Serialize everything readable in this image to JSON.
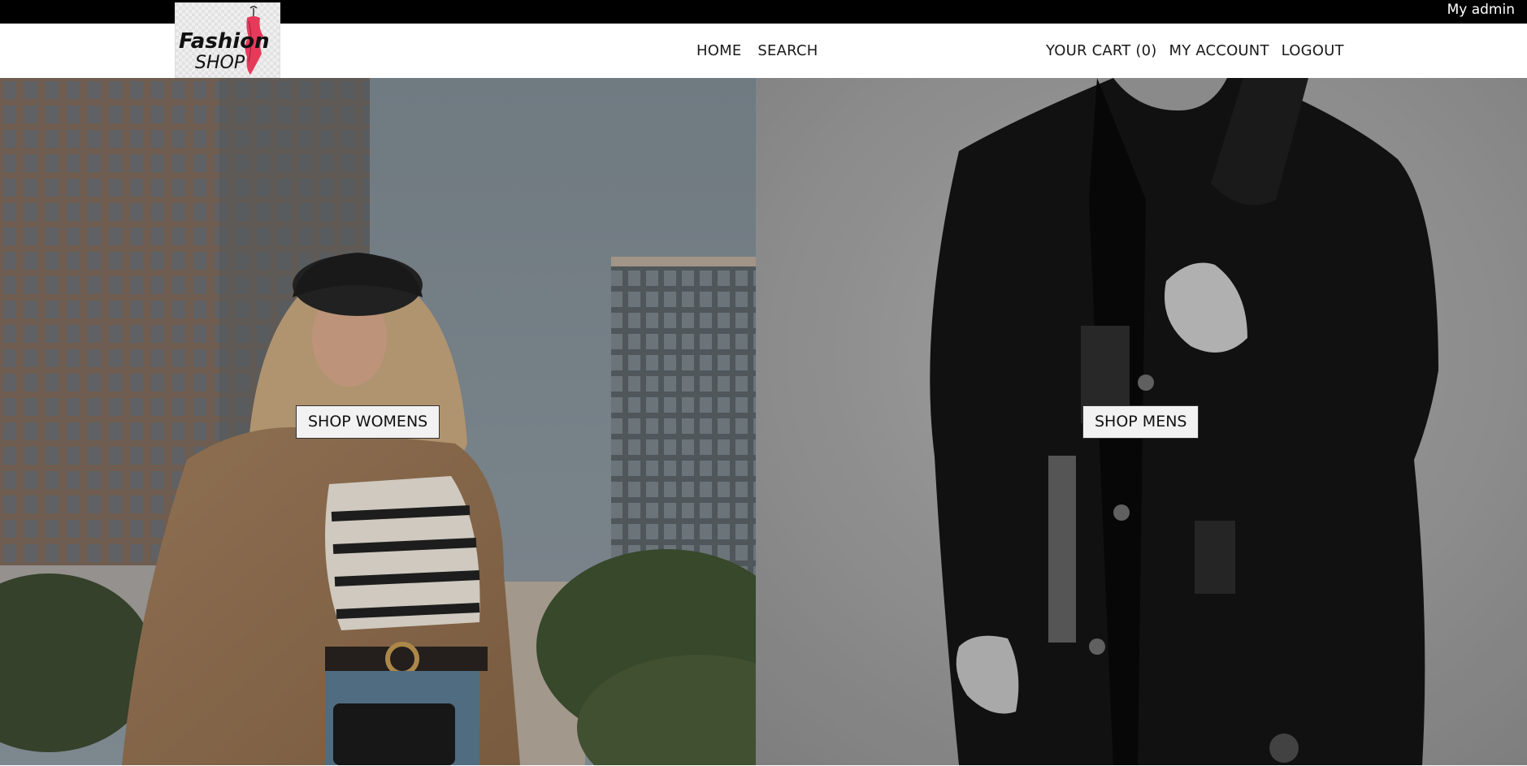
{
  "topbar": {
    "user_label": "My admin"
  },
  "logo": {
    "line1": "Fashion",
    "line2": "SHOP",
    "accent": "#e63a5b"
  },
  "nav": {
    "center": [
      {
        "label": "HOME"
      },
      {
        "label": "SEARCH"
      }
    ],
    "right": [
      {
        "label": "YOUR CART (0)"
      },
      {
        "label": "MY ACCOUNT"
      },
      {
        "label": "LOGOUT"
      }
    ]
  },
  "hero": {
    "women_button": "SHOP WOMENS",
    "mens_button": "SHOP MENS"
  },
  "colors": {
    "topbar_bg": "#000000",
    "nav_bg": "#ffffff",
    "button_bg": "#f2f2f2"
  }
}
